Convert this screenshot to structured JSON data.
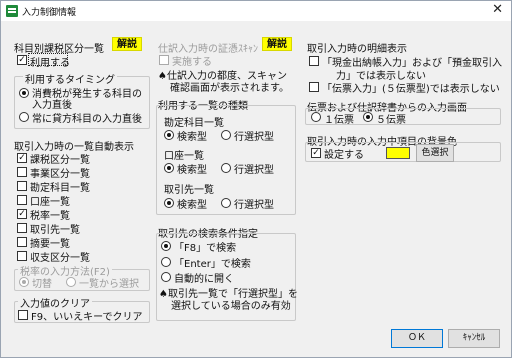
{
  "window": {
    "title": "入力制御情報",
    "close_glyph": "✕"
  },
  "left": {
    "section1_title": "科目別課税区分一覧",
    "section1_badge": "解説",
    "use_label": "利用する",
    "timing_group": "利用するタイミング",
    "timing_opt1_line1": "消費税が発生する科目の",
    "timing_opt1_line2": "入力直後",
    "timing_opt2": "常に貸方科目の入力直後",
    "auto_title": "取引入力時の一覧自動表示",
    "auto_items": [
      "課税区分一覧",
      "事業区分一覧",
      "勘定科目一覧",
      "口座一覧",
      "税率一覧",
      "取引先一覧",
      "摘要一覧",
      "収支区分一覧"
    ],
    "auto_checks": [
      "✓",
      "",
      "",
      "",
      "✓",
      "",
      "",
      ""
    ],
    "taxrate_group": "税率の入力方法(F2)",
    "taxrate_opt1": "切替",
    "taxrate_opt2": "一覧から選択",
    "clear_group": "入力値のクリア",
    "clear_label": "F9、いいえキーでクリア"
  },
  "middle": {
    "voucher_title": "仕訳入力時の証憑ｽｷｬﾝ",
    "voucher_badge": "解説",
    "voucher_exec": "実施する",
    "voucher_note_line1": "♠仕訳入力の都度、スキャン",
    "voucher_note_line2": "確認画面が表示されます。",
    "kind_group": "利用する一覧の種類",
    "list1_label": "勘定科目一覧",
    "list2_label": "口座一覧",
    "list3_label": "取引先一覧",
    "opt_search": "検索型",
    "opt_row": "行選択型",
    "partner_group": "取引先の検索条件指定",
    "partner_opt1": "「F8」で検索",
    "partner_opt2": "「Enter」で検索",
    "partner_opt3": "自動的に開く",
    "partner_note_line1": "♠取引先一覧で「行選択型」を",
    "partner_note_line2": "選択している場合のみ有効"
  },
  "right": {
    "detail_title": "取引入力時の明細表示",
    "detail_opt1_line1": "「現金出納帳入力」および「預金取引入",
    "detail_opt1_line2": "力」では表示しない",
    "detail_opt2": "「伝票入力」(５伝票型)では表示しない",
    "slip_group": "伝票および仕訳辞書からの入力画面",
    "slip_opt1": "１伝票",
    "slip_opt2": "５伝票",
    "bg_title": "取引入力時の入力中項目の背景色",
    "bg_setting": "設定する",
    "bg_color": "#ffff00",
    "color_button": "色選択"
  },
  "footer": {
    "ok": "ＯＫ",
    "cancel": "ｷｬﾝｾﾙ"
  }
}
